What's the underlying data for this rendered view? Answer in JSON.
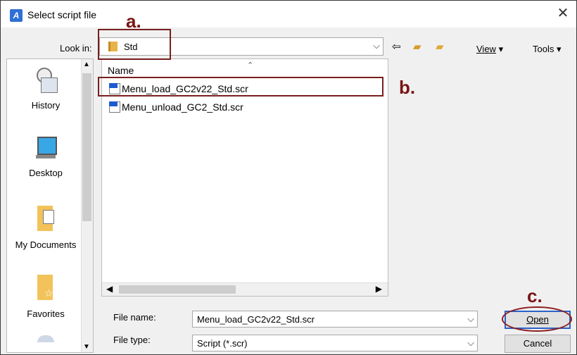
{
  "window": {
    "title": "Select script file",
    "close_glyph": "✕"
  },
  "lookin": {
    "label": "Look in:",
    "value": "Std"
  },
  "toolbar": {
    "view_label": "View",
    "tools_label": "Tools"
  },
  "places": [
    "History",
    "Desktop",
    "My Documents",
    "Favorites"
  ],
  "file_list": {
    "column_header": "Name",
    "files": [
      "Menu_load_GC2v22_Std.scr",
      "Menu_unload_GC2_Std.scr"
    ]
  },
  "form": {
    "file_name_label": "File name:",
    "file_name_value": "Menu_load_GC2v22_Std.scr",
    "file_type_label": "File type:",
    "file_type_value": "Script (*.scr)"
  },
  "buttons": {
    "open": "Open",
    "cancel": "Cancel"
  },
  "annotations": {
    "a": "a.",
    "b": "b.",
    "c": "c."
  },
  "colors": {
    "annotation": "#7a1414",
    "default_button_border": "#2a62c7"
  }
}
